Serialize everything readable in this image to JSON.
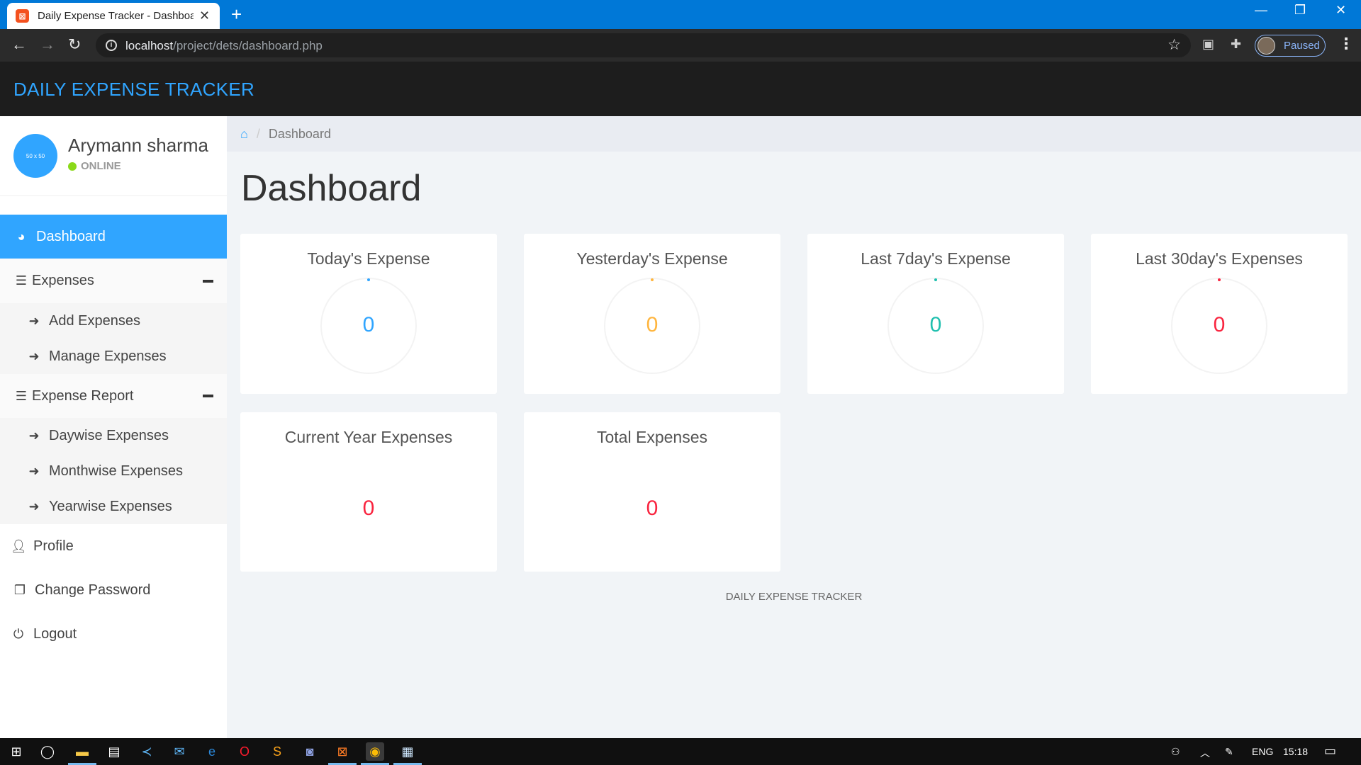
{
  "browser": {
    "tab_title": "Daily Expense Tracker - Dashboard",
    "url_host": "localhost",
    "url_path": "/project/dets/dashboard.php",
    "profile_label": "Paused"
  },
  "app": {
    "brand": "DAILY EXPENSE TRACKER",
    "accent_color": "#30a5ff"
  },
  "user": {
    "name": "Arymann sharma",
    "status": "ONLINE",
    "avatar_text": "50 x 50"
  },
  "sidebar": {
    "dashboard": "Dashboard",
    "expenses": "Expenses",
    "add_expenses": "Add Expenses",
    "manage_expenses": "Manage Expenses",
    "expense_report": "Expense Report",
    "daywise": "Daywise Expenses",
    "monthwise": "Monthwise Expenses",
    "yearwise": "Yearwise Expenses",
    "profile": "Profile",
    "change_password": "Change Password",
    "logout": "Logout"
  },
  "breadcrumb": {
    "current": "Dashboard"
  },
  "page_title": "Dashboard",
  "cards": [
    {
      "title": "Today's Expense",
      "value": "0",
      "color": "#30a5ff"
    },
    {
      "title": "Yesterday's Expense",
      "value": "0",
      "color": "#ffb53e"
    },
    {
      "title": "Last 7day's Expense",
      "value": "0",
      "color": "#1ebfae"
    },
    {
      "title": "Last 30day's Expenses",
      "value": "0",
      "color": "#f9243f"
    },
    {
      "title": "Current Year Expenses",
      "value": "0",
      "color": "#f9243f"
    },
    {
      "title": "Total Expenses",
      "value": "0",
      "color": "#f9243f"
    }
  ],
  "footer": "DAILY EXPENSE TRACKER",
  "taskbar": {
    "language": "ENG",
    "time": "15:18"
  }
}
